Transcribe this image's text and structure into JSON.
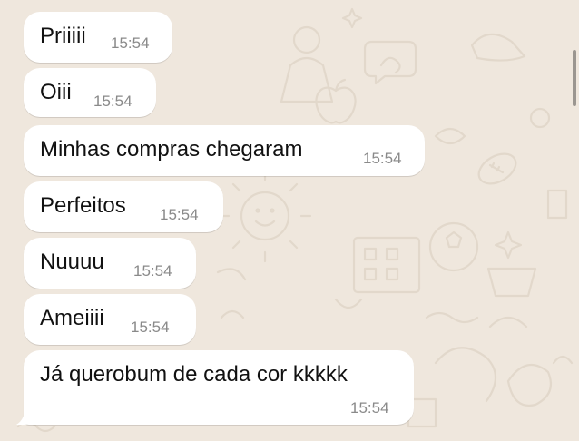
{
  "chat": {
    "wallpaper_color": "#efe7dd",
    "bubble_color": "#ffffff",
    "messages": [
      {
        "text": "Priiiii",
        "time": "15:54"
      },
      {
        "text": "Oiii",
        "time": "15:54"
      },
      {
        "text": "Minhas compras chegaram",
        "time": "15:54"
      },
      {
        "text": "Perfeitos",
        "time": "15:54"
      },
      {
        "text": "Nuuuu",
        "time": "15:54"
      },
      {
        "text": "Ameiiii",
        "time": "15:54"
      },
      {
        "text": "Já querobum de cada cor kkkkk",
        "time": "15:54"
      }
    ]
  }
}
